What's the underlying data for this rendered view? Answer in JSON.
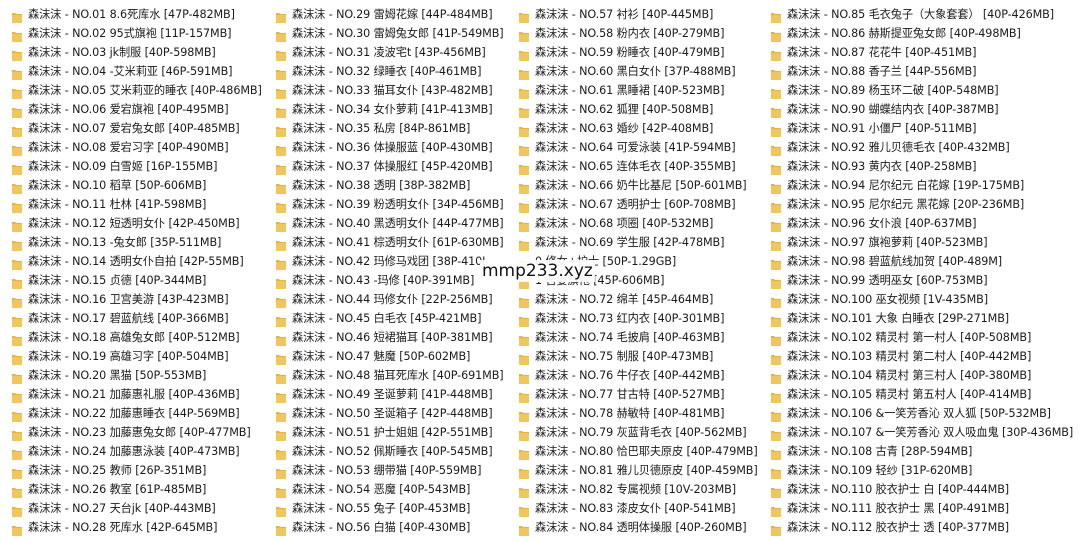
{
  "watermark": "mmp233.xyz",
  "colors": {
    "folder": "#e8b33c",
    "folder_light": "#f6d77a",
    "text": "#1a1a1a"
  },
  "icon": "folder-icon",
  "columns": [
    [
      "森沫沫 - NO.01 8.6死库水 [47P-482MB]",
      "森沫沫 - NO.02 95式旗袍 [11P-157MB]",
      "森沫沫 - NO.03 jk制服 [40P-598MB]",
      "森沫沫 - NO.04 -艾米莉亚 [46P-591MB]",
      "森沫沫 - NO.05 艾米莉亚的睡衣 [40P-486MB]",
      "森沫沫 - NO.06 爱宕旗袍 [40P-495MB]",
      "森沫沫 - NO.07 爱宕兔女郎 [40P-485MB]",
      "森沫沫 - NO.08 爱宕习字 [40P-490MB]",
      "森沫沫 - NO.09 白雪姬 [16P-155MB]",
      "森沫沫 - NO.10 稻草 [50P-606MB]",
      "森沫沫 - NO.11 杜林 [41P-598MB]",
      "森沫沫 - NO.12 短透明女仆 [42P-450MB]",
      "森沫沫 - NO.13 -兔女郎 [35P-511MB]",
      "森沫沫 - NO.14 透明女仆自拍 [42P-55MB]",
      "森沫沫 - NO.15 贞德 [40P-344MB]",
      "森沫沫 - NO.16 卫宫美游 [43P-423MB]",
      "森沫沫 - NO.17 碧蓝航线 [40P-366MB]",
      "森沫沫 - NO.18 高雄兔女郎 [40P-512MB]",
      "森沫沫 - NO.19 高雄习字 [40P-504MB]",
      "森沫沫 - NO.20 黑猫 [50P-553MB]",
      "森沫沫 - NO.21 加藤惠礼服 [40P-436MB]",
      "森沫沫 - NO.22 加藤惠睡衣 [44P-569MB]",
      "森沫沫 - NO.23 加藤惠兔女郎 [40P-477MB]",
      "森沫沫 - NO.24 加藤惠泳装 [40P-473MB]",
      "森沫沫 - NO.25 教师 [26P-351MB]",
      "森沫沫 - NO.26 教室 [61P-485MB]",
      "森沫沫 - NO.27 天台jk [40P-443MB]",
      "森沫沫 - NO.28 死库水 [42P-645MB]"
    ],
    [
      "森沫沫 - NO.29 雷姆花嫁 [44P-484MB]",
      "森沫沫 - NO.30 雷姆兔女郎 [41P-549MB]",
      "森沫沫 - NO.31 凌波宅t [43P-456MB]",
      "森沫沫 - NO.32 绿睡衣 [40P-461MB]",
      "森沫沫 - NO.33 猫耳女仆 [43P-482MB]",
      "森沫沫 - NO.34 女仆萝莉 [41P-413MB]",
      "森沫沫 - NO.35 私房 [84P-861MB]",
      "森沫沫 - NO.36 体操服蓝 [40P-430MB]",
      "森沫沫 - NO.37 体操服红 [45P-420MB]",
      "森沫沫 - NO.38 透明 [38P-382MB]",
      "森沫沫 - NO.39 粉透明女仆 [34P-456MB]",
      "森沫沫 - NO.40 黑透明女仆 [44P-477MB]",
      "森沫沫 - NO.41 棕透明女仆 [61P-630MB]",
      "森沫沫 - NO.42 玛修马戏团 [38P-410I",
      "森沫沫 - NO.43 -玛修 [40P-391MB]",
      "森沫沫 - NO.44 玛修女仆 [22P-256MB]",
      "森沫沫 - NO.45 白毛衣 [45P-421MB]",
      "森沫沫 - NO.46 短裙猫耳 [40P-381MB]",
      "森沫沫 - NO.47 魅魔 [50P-602MB]",
      "森沫沫 - NO.48 猫耳死库水 [40P-691MB]",
      "森沫沫 - NO.49 圣诞萝莉 [41P-448MB]",
      "森沫沫 - NO.50 圣诞箱子 [42P-448MB]",
      "森沫沫 - NO.51 护士姐姐 [42P-551MB]",
      "森沫沫 - NO.52 佩斯睡衣 [40P-545MB]",
      "森沫沫 - NO.53 绷带猫 [40P-559MB]",
      "森沫沫 - NO.54 恶魔 [40P-543MB]",
      "森沫沫 - NO.55 兔子 [40P-453MB]",
      "森沫沫 - NO.56 白猫 [40P-430MB]"
    ],
    [
      "森沫沫 - NO.57 衬衫 [40P-445MB]",
      "森沫沫 - NO.58 粉内衣 [40P-279MB]",
      "森沫沫 - NO.59 粉睡衣 [40P-479MB]",
      "森沫沫 - NO.60 黑白女仆 [37P-488MB]",
      "森沫沫 - NO.61 黑睡裙 [40P-523MB]",
      "森沫沫 - NO.62 狐狸 [40P-508MB]",
      "森沫沫 - NO.63 婚纱 [42P-408MB]",
      "森沫沫 - NO.64 可爱泳装 [41P-594MB]",
      "森沫沫 - NO.65 连体毛衣 [40P-355MB]",
      "森沫沫 - NO.66 奶牛比基尼 [50P-601MB]",
      "森沫沫 - NO.67 透明护士 [60P-708MB]",
      "森沫沫 - NO.68 项圈 [40P-532MB]",
      "森沫沫 - NO.69 学生服 [42P-478MB]",
      "0 修女+护士 [50P-1.29GB]",
      "1 吾妻旗袍 [45P-606MB]",
      "森沫沫 - NO.72 绵羊 [45P-464MB]",
      "森沫沫 - NO.73 红内衣 [40P-301MB]",
      "森沫沫 - NO.74 毛披肩 [40P-463MB]",
      "森沫沫 - NO.75 制服 [40P-473MB]",
      "森沫沫 - NO.76 牛仔衣 [40P-442MB]",
      "森沫沫 - NO.77 甘古特 [40P-527MB]",
      "森沫沫 - NO.78 赫敏特 [40P-481MB]",
      "森沫沫 - NO.79 灰蓝背毛衣 [40P-562MB]",
      "森沫沫 - NO.80 恰巴耶夫原皮 [40P-479MB]",
      "森沫沫 - NO.81 雅儿贝德原皮 [40P-459MB]",
      "森沫沫 - NO.82 专属视频 [10V-203MB]",
      "森沫沫 - NO.83 漆皮女仆 [40P-541MB]",
      "森沫沫 - NO.84 透明体操服 [40P-260MB]"
    ],
    [
      "森沫沫 - NO.85 毛衣兔子（大象套套） [40P-426MB]",
      "森沫沫 - NO.86 赫斯提亚兔女郎 [40P-498MB]",
      "森沫沫 - NO.87 花花牛 [40P-451MB]",
      "森沫沫 - NO.88 香子兰 [44P-556MB]",
      "森沫沫 - NO.89 杨玉环二破 [40P-548MB]",
      "森沫沫 - NO.90 蝴蝶结内衣 [40P-387MB]",
      "森沫沫 - NO.91 小僵尸 [40P-511MB]",
      "森沫沫 - NO.92 雅儿贝德毛衣 [40P-432MB]",
      "森沫沫 - NO.93 黄内衣 [40P-258MB]",
      "森沫沫 - NO.94 尼尔纪元 白花嫁 [19P-175MB]",
      "森沫沫 - NO.95 尼尔纪元 黑花嫁 [20P-236MB]",
      "森沫沫 - NO.96 女仆浪 [40P-637MB]",
      "森沫沫 - NO.97 旗袍萝莉 [40P-523MB]",
      "森沫沫 - NO.98 碧蓝航线加贺 [40P-489M]",
      "森沫沫 - NO.99 透明巫女 [60P-753MB]",
      "森沫沫 - NO.100 巫女视频 [1V-435MB]",
      "森沫沫 - NO.101 大象 白睡衣 [29P-271MB]",
      "森沫沫 - NO.102 精灵村 第一村人 [40P-508MB]",
      "森沫沫 - NO.103 精灵村 第二村人 [40P-442MB]",
      "森沫沫 - NO.104 精灵村 第三村人 [40P-380MB]",
      "森沫沫 - NO.105 精灵村 第五村人 [40P-414MB]",
      "森沫沫 - NO.106 &一笑芳香沁 双人狐 [50P-532MB]",
      "森沫沫 - NO.107 &一笑芳香沁 双人吸血鬼 [30P-436MB]",
      "森沫沫 - NO.108 古青 [28P-594MB]",
      "森沫沫 - NO.109 轻纱 [31P-620MB]",
      "森沫沫 - NO.110 胶衣护士 白 [40P-444MB]",
      "森沫沫 - NO.111 胶衣护士 黑 [40P-491MB]",
      "森沫沫 - NO.112 胶衣护士 透 [40P-377MB]"
    ]
  ]
}
